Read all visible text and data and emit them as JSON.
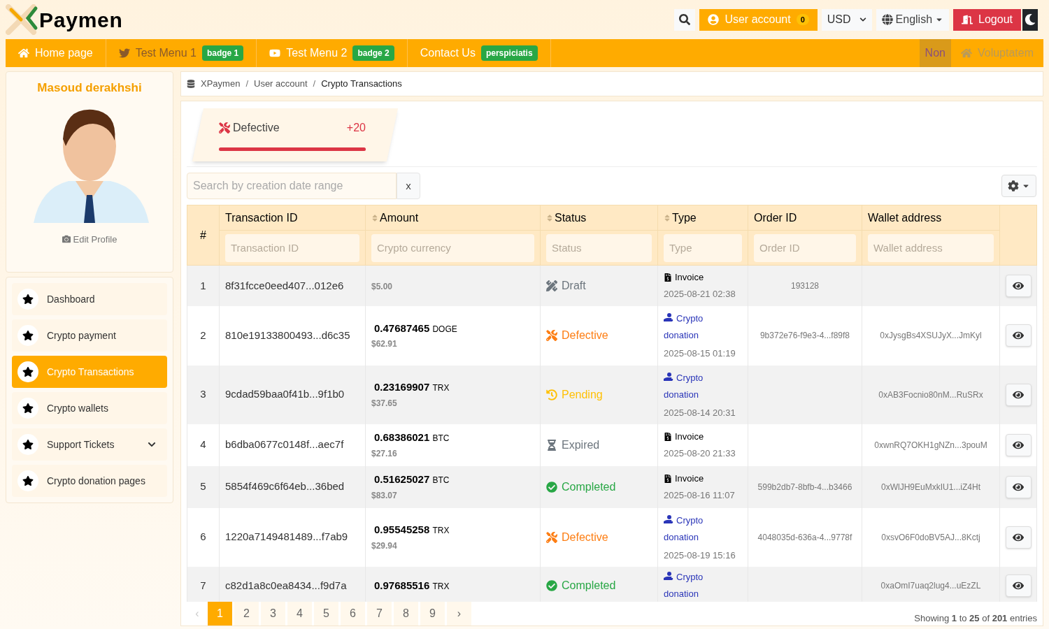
{
  "brand": {
    "name": "Paymen"
  },
  "header": {
    "account": {
      "label": "User account",
      "count": "0"
    },
    "currency": "USD",
    "language": "English",
    "logout": "Logout"
  },
  "nav": {
    "items": [
      {
        "kind": "home",
        "label": "Home page",
        "disabled": false
      },
      {
        "kind": "bird",
        "label": "Test Menu 1",
        "badge": "badge 1",
        "disabled": true
      },
      {
        "kind": "video",
        "label": "Test Menu 2",
        "badge": "badge 2",
        "disabled": false
      },
      {
        "kind": "plain",
        "label": "Contact Us",
        "badge": "perspiciatis",
        "disabled": false
      }
    ],
    "right_items": [
      {
        "kind": "plain",
        "label": "Non",
        "selected": true,
        "disabled": false
      },
      {
        "kind": "home",
        "label": "Voluptatem",
        "selected": false,
        "disabled": true
      }
    ]
  },
  "profile": {
    "name": "Masoud derakhshi",
    "edit": "Edit Profile"
  },
  "sidebar": {
    "items": [
      {
        "label": "Dashboard",
        "selected": false
      },
      {
        "label": "Crypto payment",
        "selected": false
      },
      {
        "label": "Crypto Transactions",
        "selected": true
      },
      {
        "label": "Crypto wallets",
        "selected": false
      },
      {
        "label": "Support Tickets",
        "selected": false,
        "expanded": false
      },
      {
        "label": "Crypto donation pages",
        "selected": false
      }
    ]
  },
  "breadcrumb": {
    "separator": "/",
    "items": [
      "XPaymen",
      "User account",
      "Crypto Transactions"
    ]
  },
  "stat": {
    "label": "Defective",
    "value": "+20",
    "level": 1
  },
  "search": {
    "placeholder": "Search by creation date range",
    "clear": "x"
  },
  "table": {
    "columns": [
      {
        "label": "#",
        "sortable": false
      },
      {
        "label": "Transaction ID",
        "sortable": false,
        "placeholder": "Transaction ID"
      },
      {
        "label": "Amount",
        "sortable": true,
        "placeholder": "Crypto currency"
      },
      {
        "label": "Status",
        "sortable": true,
        "placeholder": "Status"
      },
      {
        "label": "Type",
        "sortable": true,
        "placeholder": "Type"
      },
      {
        "label": "Order ID",
        "sortable": false,
        "placeholder": "Order ID"
      },
      {
        "label": "Wallet address",
        "sortable": false,
        "placeholder": "Wallet address"
      }
    ],
    "rows": [
      {
        "index": "1",
        "tx": "8f31fcce0eed407...012e6",
        "usd": "$5.00",
        "status": {
          "kind": "draft",
          "label": "Draft"
        },
        "type": {
          "kind": "invoice",
          "label": "Invoice"
        },
        "date": "2025-08-21 02:38",
        "order_id": "193128"
      },
      {
        "index": "2",
        "tx": "810e19133800493...d6c35",
        "amount": "0.47687465",
        "currency": "DOGE",
        "usd": "$62.91",
        "status": {
          "kind": "defective",
          "label": "Defective"
        },
        "type": {
          "kind": "donation",
          "label": "Crypto donation"
        },
        "date": "2025-08-15 01:19",
        "order_id": "9b372e76-f9e3-4...f89f8",
        "wallet": "0xJysgBs4XSUJyX...JmKyl"
      },
      {
        "index": "3",
        "tx": "9cdad59baa0f41b...9f1b0",
        "amount": "0.23169907",
        "currency": "TRX",
        "usd": "$37.65",
        "status": {
          "kind": "pending",
          "label": "Pending"
        },
        "type": {
          "kind": "donation",
          "label": "Crypto donation"
        },
        "date": "2025-08-14 20:31",
        "wallet": "0xAB3Focnio80nM...RuSRx"
      },
      {
        "index": "4",
        "tx": "b6dba0677c0148f...aec7f",
        "amount": "0.68386021",
        "currency": "BTC",
        "usd": "$27.16",
        "status": {
          "kind": "expired",
          "label": "Expired"
        },
        "type": {
          "kind": "invoice",
          "label": "Invoice"
        },
        "date": "2025-08-20 21:33",
        "wallet": "0xwnRQ7OKH1gNZn...3pouM"
      },
      {
        "index": "5",
        "tx": "5854f469c6f64eb...36bed",
        "amount": "0.51625027",
        "currency": "BTC",
        "usd": "$83.07",
        "status": {
          "kind": "completed",
          "label": "Completed"
        },
        "type": {
          "kind": "invoice",
          "label": "Invoice"
        },
        "date": "2025-08-16 11:07",
        "order_id": "599b2db7-8bfb-4...b3466",
        "wallet": "0xWlJH9EuMxkIU1...iZ4Ht"
      },
      {
        "index": "6",
        "tx": "1220a7149481489...f7ab9",
        "amount": "0.95545258",
        "currency": "TRX",
        "usd": "$29.94",
        "status": {
          "kind": "defective",
          "label": "Defective"
        },
        "type": {
          "kind": "donation",
          "label": "Crypto donation"
        },
        "date": "2025-08-19 15:16",
        "order_id": "4048035d-636a-4...9778f",
        "wallet": "0xsvO6F0doBV5AJ...8Kctj"
      },
      {
        "index": "7",
        "tx": "c82d1a8c0ea8434...f9d7a",
        "amount": "0.97685516",
        "currency": "TRX",
        "status": {
          "kind": "completed",
          "label": "Completed"
        },
        "type": {
          "kind": "donation",
          "label": "Crypto donation"
        },
        "wallet": "0xaOmI7uaq2lug4...uEzZL"
      }
    ]
  },
  "pagination": {
    "prev": "‹",
    "next": "›",
    "pages": [
      {
        "label": "1",
        "selected": true
      },
      {
        "label": "2",
        "selected": false
      },
      {
        "label": "3",
        "selected": false
      },
      {
        "label": "4",
        "selected": false
      },
      {
        "label": "5",
        "selected": false
      },
      {
        "label": "6",
        "selected": false
      },
      {
        "label": "7",
        "selected": false
      },
      {
        "label": "8",
        "selected": false
      },
      {
        "label": "9",
        "selected": false
      }
    ]
  },
  "footer": {
    "info": "Showing **1** to **25** of **201** entries"
  }
}
